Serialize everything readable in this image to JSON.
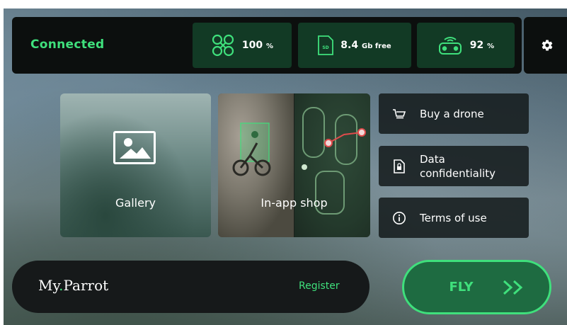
{
  "topbar": {
    "status": "Connected",
    "drone_battery": {
      "value": "100",
      "unit": "%",
      "icon": "drone-icon"
    },
    "sd_storage": {
      "value": "8.4",
      "unit": "Gb free",
      "icon": "sd-card-icon",
      "icon_text": "SD"
    },
    "controller_battery": {
      "value": "92",
      "unit": "%",
      "icon": "controller-icon"
    },
    "settings_icon": "gear-icon"
  },
  "tiles": {
    "gallery": {
      "label": "Gallery",
      "icon": "image-icon"
    },
    "shop": {
      "label": "In-app shop"
    }
  },
  "links": [
    {
      "label": "Buy a drone",
      "icon": "cart-icon"
    },
    {
      "label": "Data confidentiality",
      "icon": "document-lock-icon"
    },
    {
      "label": "Terms of use",
      "icon": "info-icon"
    }
  ],
  "bottom": {
    "brand_prefix": "My",
    "brand_dot": ".",
    "brand_suffix": "Parrot",
    "register": "Register",
    "fly": "FLY"
  },
  "colors": {
    "accent": "#3fe07c",
    "stat_bg": "#123a25",
    "bar_bg": "#0c0f0e",
    "fly_bg": "#1e6b41"
  }
}
